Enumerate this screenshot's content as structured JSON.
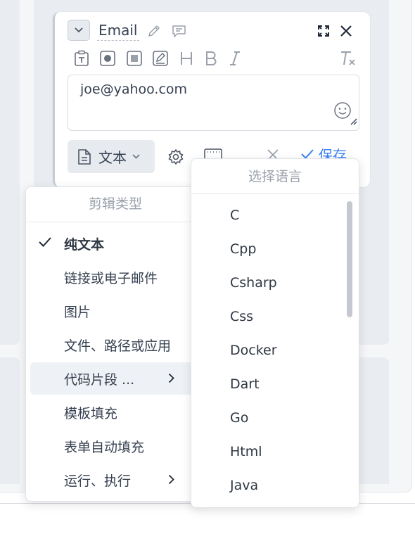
{
  "editor": {
    "title": "Email",
    "content": "joe@yahoo.com",
    "type_label": "文本",
    "save_label": "保存"
  },
  "icons": {
    "collapse": "chevron-down-icon",
    "edit": "pencil-icon",
    "comment": "comment-icon",
    "expand": "expand-icon",
    "close": "close-icon",
    "tools": [
      "clipboard-text-icon",
      "record-icon",
      "stop-icon",
      "draw-icon",
      "heading-icon",
      "bold-icon",
      "italic-icon",
      "clear-format-icon"
    ],
    "emoji": "emoji-icon",
    "document": "document-icon",
    "settings": "gear-icon",
    "keyboard": "keyboard-icon",
    "cancel": "cancel-icon",
    "check": "check-icon"
  },
  "clip_type_menu": {
    "header": "剪辑类型",
    "items": [
      {
        "label": "纯文本",
        "selected": true
      },
      {
        "label": "链接或电子邮件"
      },
      {
        "label": "图片"
      },
      {
        "label": "文件、路径或应用"
      },
      {
        "label": "代码片段 ...",
        "submenu": true,
        "active": true
      },
      {
        "label": "模板填充"
      },
      {
        "label": "表单自动填充"
      },
      {
        "label": "运行、执行",
        "submenu": true
      }
    ]
  },
  "language_menu": {
    "header": "选择语言",
    "items": [
      "C",
      "Cpp",
      "Csharp",
      "Css",
      "Docker",
      "Dart",
      "Go",
      "Html",
      "Java"
    ]
  },
  "colors": {
    "accent": "#3b82f6",
    "muted": "#9aa1ab",
    "text": "#374151"
  }
}
